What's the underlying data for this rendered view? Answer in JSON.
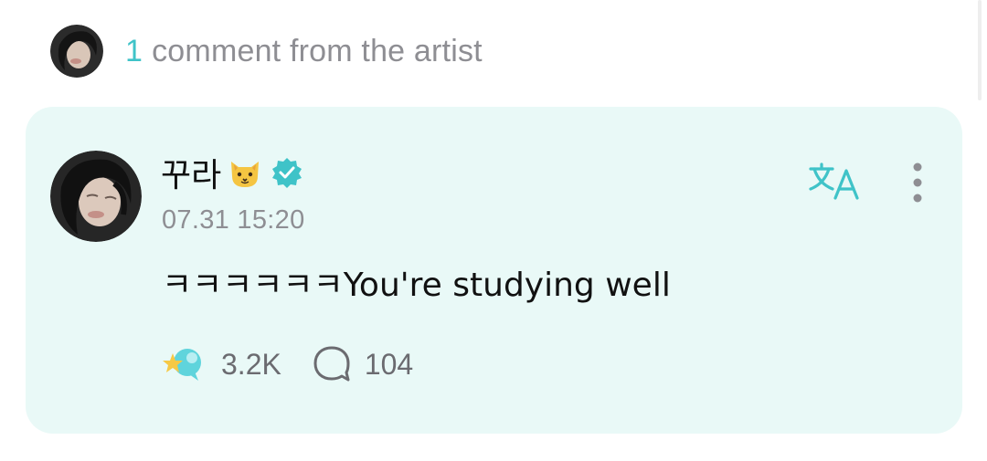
{
  "header": {
    "count": "1",
    "label": "comment from the artist",
    "avatar_icon": "artist-avatar"
  },
  "comment": {
    "author_name": "꾸라",
    "author_emoji_icon": "cat-face-icon",
    "verified_icon": "verified-badge-icon",
    "timestamp": "07.31 15:20",
    "text": "ㅋㅋㅋㅋㅋㅋYou're studying well",
    "translate_icon": "translate-icon",
    "more_icon": "more-vertical-icon",
    "like_icon": "star-bubble-like-icon",
    "like_count": "3.2K",
    "reply_icon": "comment-bubble-icon",
    "reply_count": "104"
  },
  "colors": {
    "accent": "#3fc3c8",
    "card_background": "#e9f9f7",
    "muted_text": "#8e8e93",
    "primary_text": "#111111"
  }
}
